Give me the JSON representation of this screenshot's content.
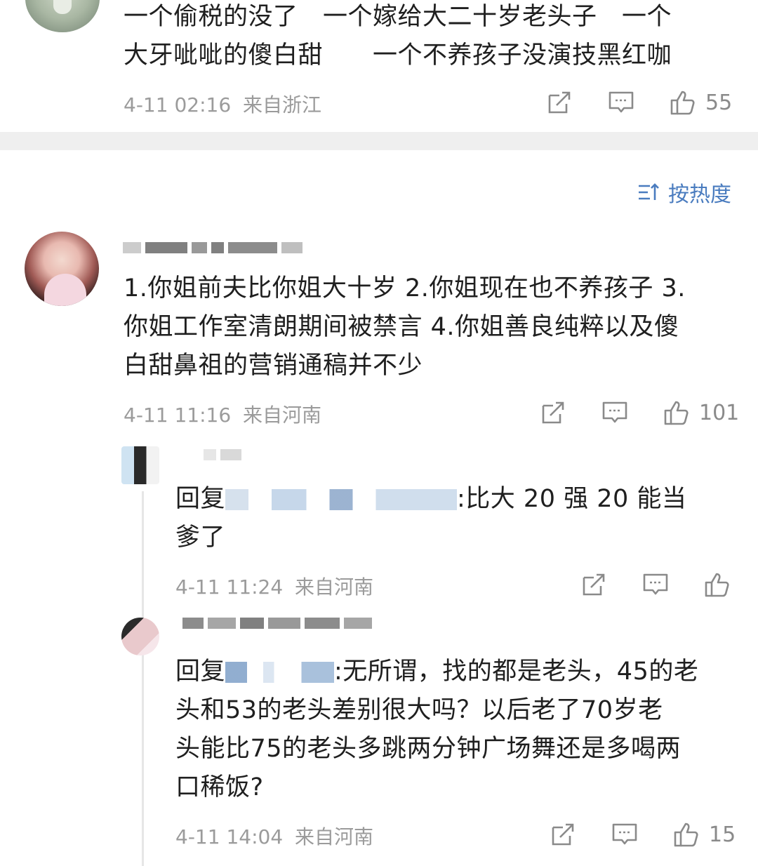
{
  "comments": [
    {
      "text_lines": [
        "一个偷税的没了　一个嫁给大二十岁老头子　一个",
        "大牙呲呲的傻白甜　　一个不养孩子没演技黑红咖"
      ],
      "time": "4-11 02:16",
      "location": "来自浙江",
      "likes": "55"
    }
  ],
  "sort": {
    "label": "按热度"
  },
  "thread": {
    "main": {
      "text_lines": [
        "1.你姐前夫比你姐大十岁  2.你姐现在也不养孩子 3.",
        "你姐工作室清朗期间被禁言 4.你姐善良纯粹以及傻",
        "白甜鼻祖的营销通稿并不少"
      ],
      "time": "4-11 11:16",
      "location": "来自河南",
      "likes": "101"
    },
    "replies": [
      {
        "prefix": "回复",
        "suffix_lines": [
          ":比大 20 强 20 能当",
          "爹了"
        ],
        "time": "4-11 11:24",
        "location": "来自河南",
        "likes": ""
      },
      {
        "prefix": "回复",
        "suffix_lines": [
          ":无所谓，找的都是老头，45的老",
          "头和53的老头差别很大吗？以后老了70岁老",
          "头能比75的老头多跳两分钟广场舞还是多喝两",
          "口稀饭?"
        ],
        "time": "4-11 14:04",
        "location": "来自河南",
        "likes": "15"
      }
    ]
  },
  "icons": {
    "share": "share-icon",
    "comment": "comment-icon",
    "like": "thumbs-up-icon",
    "sort": "sort-icon"
  },
  "colors": {
    "link_blue": "#4a7cbf",
    "meta_gray": "#9b9b9b",
    "separator": "#efefef"
  }
}
